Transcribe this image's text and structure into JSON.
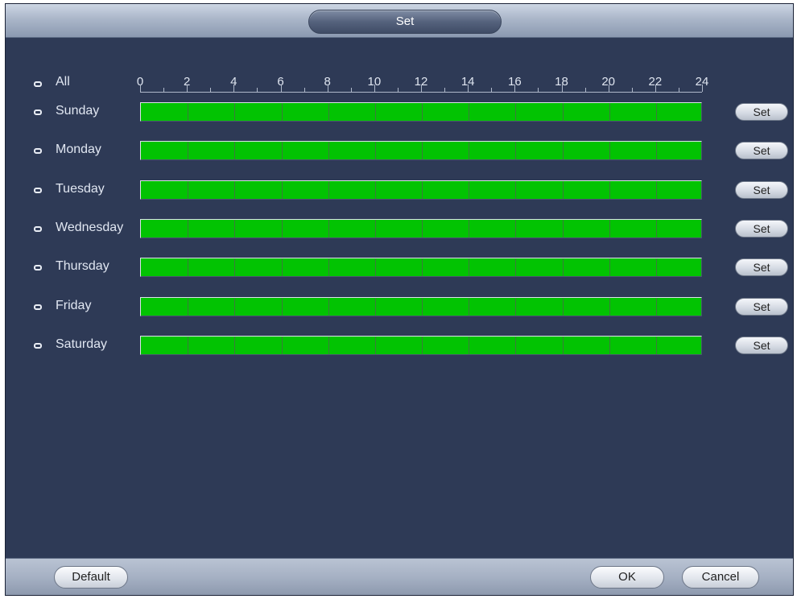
{
  "dialog": {
    "title": "Set"
  },
  "schedule": {
    "all_label": "All",
    "hour_labels": [
      "0",
      "2",
      "4",
      "6",
      "8",
      "10",
      "12",
      "14",
      "16",
      "18",
      "20",
      "22",
      "24"
    ],
    "days": [
      {
        "label": "Sunday",
        "set_label": "Set",
        "active_hours": [
          0,
          24
        ]
      },
      {
        "label": "Monday",
        "set_label": "Set",
        "active_hours": [
          0,
          24
        ]
      },
      {
        "label": "Tuesday",
        "set_label": "Set",
        "active_hours": [
          0,
          24
        ]
      },
      {
        "label": "Wednesday",
        "set_label": "Set",
        "active_hours": [
          0,
          24
        ]
      },
      {
        "label": "Thursday",
        "set_label": "Set",
        "active_hours": [
          0,
          24
        ]
      },
      {
        "label": "Friday",
        "set_label": "Set",
        "active_hours": [
          0,
          24
        ]
      },
      {
        "label": "Saturday",
        "set_label": "Set",
        "active_hours": [
          0,
          24
        ]
      }
    ],
    "active_color": "#02c302"
  },
  "footer": {
    "default_label": "Default",
    "ok_label": "OK",
    "cancel_label": "Cancel"
  }
}
